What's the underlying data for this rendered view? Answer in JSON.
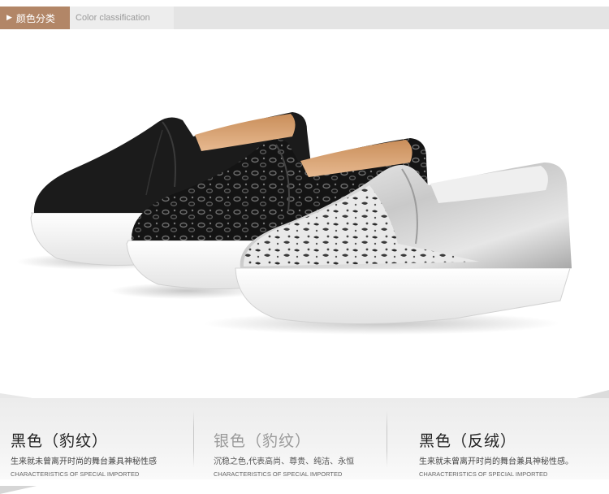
{
  "header": {
    "tag_label": "颜色分类",
    "subtitle": "Color classification"
  },
  "colors": [
    {
      "title": "黑色（豹纹）",
      "desc": "生来就未曾离开时尚的舞台兼具神秘性感",
      "en": "CHARACTERISTICS OF SPECIAL IMPORTED"
    },
    {
      "title": "银色（豹纹）",
      "desc": "沉稳之色,代表高尚、尊贵、纯洁、永恒",
      "en": "CHARACTERISTICS OF SPECIAL IMPORTED"
    },
    {
      "title": "黑色（反绒）",
      "desc": "生来就未曾离开时尚的舞台兼具神秘性感。",
      "en": "CHARACTERISTICS OF SPECIAL IMPORTED"
    }
  ]
}
